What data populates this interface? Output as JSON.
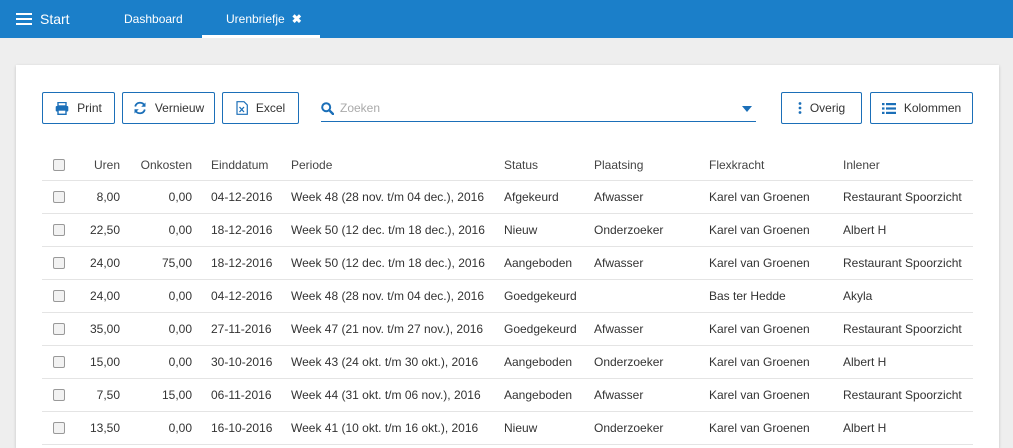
{
  "topbar": {
    "start_label": "Start",
    "tabs": [
      {
        "label": "Dashboard"
      },
      {
        "label": "Urenbriefje",
        "close": "✖"
      }
    ]
  },
  "toolbar": {
    "print_label": "Print",
    "vernieuw_label": "Vernieuw",
    "excel_label": "Excel",
    "overig_label": "Overig",
    "kolommen_label": "Kolommen",
    "search_placeholder": "Zoeken"
  },
  "colors": {
    "accent": "#1b7fc9",
    "border_accent": "#1b6fb8"
  },
  "table": {
    "columns": [
      "Uren",
      "Onkosten",
      "Einddatum",
      "Periode",
      "Status",
      "Plaatsing",
      "Flexkracht",
      "Inlener"
    ],
    "rows": [
      {
        "uren": "8,00",
        "onkosten": "0,00",
        "einddatum": "04-12-2016",
        "periode": "Week 48 (28 nov. t/m 04 dec.), 2016",
        "status": "Afgekeurd",
        "plaatsing": "Afwasser",
        "flexkracht": "Karel van Groenen",
        "inlener": "Restaurant Spoorzicht"
      },
      {
        "uren": "22,50",
        "onkosten": "0,00",
        "einddatum": "18-12-2016",
        "periode": "Week 50 (12 dec. t/m 18 dec.), 2016",
        "status": "Nieuw",
        "plaatsing": "Onderzoeker",
        "flexkracht": "Karel van Groenen",
        "inlener": "Albert H"
      },
      {
        "uren": "24,00",
        "onkosten": "75,00",
        "einddatum": "18-12-2016",
        "periode": "Week 50 (12 dec. t/m 18 dec.), 2016",
        "status": "Aangeboden",
        "plaatsing": "Afwasser",
        "flexkracht": "Karel van Groenen",
        "inlener": "Restaurant Spoorzicht"
      },
      {
        "uren": "24,00",
        "onkosten": "0,00",
        "einddatum": "04-12-2016",
        "periode": "Week 48 (28 nov. t/m 04 dec.), 2016",
        "status": "Goedgekeurd",
        "plaatsing": "",
        "flexkracht": "Bas ter Hedde",
        "inlener": "Akyla"
      },
      {
        "uren": "35,00",
        "onkosten": "0,00",
        "einddatum": "27-11-2016",
        "periode": "Week 47 (21 nov. t/m 27 nov.), 2016",
        "status": "Goedgekeurd",
        "plaatsing": "Afwasser",
        "flexkracht": "Karel van Groenen",
        "inlener": "Restaurant Spoorzicht"
      },
      {
        "uren": "15,00",
        "onkosten": "0,00",
        "einddatum": "30-10-2016",
        "periode": "Week 43 (24 okt. t/m 30 okt.), 2016",
        "status": "Aangeboden",
        "plaatsing": "Onderzoeker",
        "flexkracht": "Karel van Groenen",
        "inlener": "Albert H"
      },
      {
        "uren": "7,50",
        "onkosten": "15,00",
        "einddatum": "06-11-2016",
        "periode": "Week 44 (31 okt. t/m 06 nov.), 2016",
        "status": "Aangeboden",
        "plaatsing": "Afwasser",
        "flexkracht": "Karel van Groenen",
        "inlener": "Restaurant Spoorzicht"
      },
      {
        "uren": "13,50",
        "onkosten": "0,00",
        "einddatum": "16-10-2016",
        "periode": "Week 41 (10 okt. t/m 16 okt.), 2016",
        "status": "Nieuw",
        "plaatsing": "Onderzoeker",
        "flexkracht": "Karel van Groenen",
        "inlener": "Albert H"
      }
    ]
  }
}
